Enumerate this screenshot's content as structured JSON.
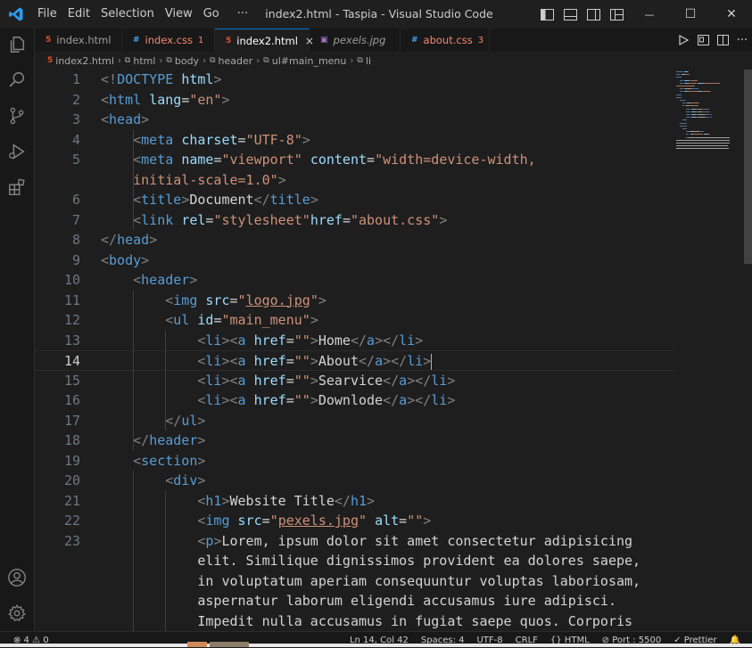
{
  "titlebar": {
    "menu": [
      "File",
      "Edit",
      "Selection",
      "View",
      "Go"
    ],
    "more": "···",
    "window_title": "index2.html - Taspia - Visual Studio Code",
    "win_controls": {
      "minimize": "—",
      "maximize": "☐",
      "close": "✕"
    }
  },
  "tabs": [
    {
      "label": "index.html",
      "icon": "5",
      "icon_color": "#e44d26",
      "active": false,
      "italic": false
    },
    {
      "label": "index.css",
      "icon": "#",
      "icon_color": "#42a5f5",
      "badge": "1",
      "label_color": "#f48771",
      "active": false,
      "italic": false
    },
    {
      "label": "index2.html",
      "icon": "5",
      "icon_color": "#e44d26",
      "active": true,
      "close": "×",
      "italic": false
    },
    {
      "label": "pexels.jpg",
      "icon": "▣",
      "icon_color": "#a074c4",
      "active": false,
      "italic": true
    },
    {
      "label": "about.css",
      "icon": "#",
      "icon_color": "#42a5f5",
      "badge": "3",
      "label_color": "#f48771",
      "active": false,
      "italic": false
    }
  ],
  "breadcrumb": [
    "index2.html",
    "html",
    "body",
    "header",
    "ul#main_menu",
    "li"
  ],
  "editor": {
    "line_numbers": [
      "1",
      "2",
      "3",
      "4",
      "5",
      "",
      "6",
      "7",
      "8",
      "9",
      "10",
      "11",
      "12",
      "13",
      "14",
      "15",
      "16",
      "17",
      "18",
      "19",
      "20",
      "21",
      "22",
      "23",
      "",
      "",
      "",
      ""
    ],
    "current_line": "14",
    "lines": [
      [
        [
          "p",
          "<!"
        ],
        [
          "tag",
          "DOCTYPE"
        ],
        [
          "x",
          " "
        ],
        [
          "attr",
          "html"
        ],
        [
          "p",
          ">"
        ]
      ],
      [
        [
          "p",
          "<"
        ],
        [
          "tag",
          "html"
        ],
        [
          "x",
          " "
        ],
        [
          "attr",
          "lang"
        ],
        [
          "x",
          "="
        ],
        [
          "str",
          "\"en\""
        ],
        [
          "p",
          ">"
        ]
      ],
      [
        [
          "p",
          "<"
        ],
        [
          "tag",
          "head"
        ],
        [
          "p",
          ">"
        ]
      ],
      [
        [
          "x",
          "    "
        ],
        [
          "p",
          "<"
        ],
        [
          "tag",
          "meta"
        ],
        [
          "x",
          " "
        ],
        [
          "attr",
          "charset"
        ],
        [
          "x",
          "="
        ],
        [
          "str",
          "\"UTF-8\""
        ],
        [
          "p",
          ">"
        ]
      ],
      [
        [
          "x",
          "    "
        ],
        [
          "p",
          "<"
        ],
        [
          "tag",
          "meta"
        ],
        [
          "x",
          " "
        ],
        [
          "attr",
          "name"
        ],
        [
          "x",
          "="
        ],
        [
          "str",
          "\"viewport\""
        ],
        [
          "x",
          " "
        ],
        [
          "attr",
          "content"
        ],
        [
          "x",
          "="
        ],
        [
          "str",
          "\"width=device-width,"
        ]
      ],
      [
        [
          "str",
          "    initial-scale=1.0\""
        ],
        [
          "p",
          ">"
        ]
      ],
      [
        [
          "x",
          "    "
        ],
        [
          "p",
          "<"
        ],
        [
          "tag",
          "title"
        ],
        [
          "p",
          ">"
        ],
        [
          "x",
          "Document"
        ],
        [
          "p",
          "</"
        ],
        [
          "tag",
          "title"
        ],
        [
          "p",
          ">"
        ]
      ],
      [
        [
          "x",
          "    "
        ],
        [
          "p",
          "<"
        ],
        [
          "tag",
          "link"
        ],
        [
          "x",
          " "
        ],
        [
          "attr",
          "rel"
        ],
        [
          "x",
          "="
        ],
        [
          "str",
          "\"stylesheet\""
        ],
        [
          "attr",
          "href"
        ],
        [
          "x",
          "="
        ],
        [
          "str",
          "\"about.css\""
        ],
        [
          "p",
          ">"
        ]
      ],
      [
        [
          "p",
          "</"
        ],
        [
          "tag",
          "head"
        ],
        [
          "p",
          ">"
        ]
      ],
      [
        [
          "p",
          "<"
        ],
        [
          "tag",
          "body"
        ],
        [
          "p",
          ">"
        ]
      ],
      [
        [
          "x",
          "    "
        ],
        [
          "p",
          "<"
        ],
        [
          "tag",
          "header"
        ],
        [
          "p",
          ">"
        ]
      ],
      [
        [
          "x",
          "        "
        ],
        [
          "p",
          "<"
        ],
        [
          "tag",
          "img"
        ],
        [
          "x",
          " "
        ],
        [
          "attr",
          "src"
        ],
        [
          "x",
          "="
        ],
        [
          "str",
          "\""
        ],
        [
          "link",
          "logo.jpg"
        ],
        [
          "str",
          "\""
        ],
        [
          "p",
          ">"
        ]
      ],
      [
        [
          "x",
          "        "
        ],
        [
          "p",
          "<"
        ],
        [
          "tag",
          "ul"
        ],
        [
          "x",
          " "
        ],
        [
          "attr",
          "id"
        ],
        [
          "x",
          "="
        ],
        [
          "str",
          "\"main_menu\""
        ],
        [
          "p",
          ">"
        ]
      ],
      [
        [
          "x",
          "            "
        ],
        [
          "p",
          "<"
        ],
        [
          "tag",
          "li"
        ],
        [
          "p",
          "><"
        ],
        [
          "tag",
          "a"
        ],
        [
          "x",
          " "
        ],
        [
          "attr",
          "href"
        ],
        [
          "x",
          "="
        ],
        [
          "str",
          "\"\""
        ],
        [
          "p",
          ">"
        ],
        [
          "x",
          "Home"
        ],
        [
          "p",
          "</"
        ],
        [
          "tag",
          "a"
        ],
        [
          "p",
          "></"
        ],
        [
          "tag",
          "li"
        ],
        [
          "p",
          ">"
        ]
      ],
      [
        [
          "x",
          "            "
        ],
        [
          "p",
          "<"
        ],
        [
          "tag",
          "li"
        ],
        [
          "p",
          "><"
        ],
        [
          "tag",
          "a"
        ],
        [
          "x",
          " "
        ],
        [
          "attr",
          "href"
        ],
        [
          "x",
          "="
        ],
        [
          "str",
          "\"\""
        ],
        [
          "p",
          ">"
        ],
        [
          "x",
          "About"
        ],
        [
          "p",
          "</"
        ],
        [
          "tag",
          "a"
        ],
        [
          "p",
          "></"
        ],
        [
          "tag",
          "li"
        ],
        [
          "p",
          ">"
        ]
      ],
      [
        [
          "x",
          "            "
        ],
        [
          "p",
          "<"
        ],
        [
          "tag",
          "li"
        ],
        [
          "p",
          "><"
        ],
        [
          "tag",
          "a"
        ],
        [
          "x",
          " "
        ],
        [
          "attr",
          "href"
        ],
        [
          "x",
          "="
        ],
        [
          "str",
          "\"\""
        ],
        [
          "p",
          ">"
        ],
        [
          "x",
          "Searvice"
        ],
        [
          "p",
          "</"
        ],
        [
          "tag",
          "a"
        ],
        [
          "p",
          "></"
        ],
        [
          "tag",
          "li"
        ],
        [
          "p",
          ">"
        ]
      ],
      [
        [
          "x",
          "            "
        ],
        [
          "p",
          "<"
        ],
        [
          "tag",
          "li"
        ],
        [
          "p",
          "><"
        ],
        [
          "tag",
          "a"
        ],
        [
          "x",
          " "
        ],
        [
          "attr",
          "href"
        ],
        [
          "x",
          "="
        ],
        [
          "str",
          "\"\""
        ],
        [
          "p",
          ">"
        ],
        [
          "x",
          "Downlode"
        ],
        [
          "p",
          "</"
        ],
        [
          "tag",
          "a"
        ],
        [
          "p",
          "></"
        ],
        [
          "tag",
          "li"
        ],
        [
          "p",
          ">"
        ]
      ],
      [
        [
          "x",
          "        "
        ],
        [
          "p",
          "</"
        ],
        [
          "tag",
          "ul"
        ],
        [
          "p",
          ">"
        ]
      ],
      [
        [
          "x",
          "    "
        ],
        [
          "p",
          "</"
        ],
        [
          "tag",
          "header"
        ],
        [
          "p",
          ">"
        ]
      ],
      [
        [
          "x",
          "    "
        ],
        [
          "p",
          "<"
        ],
        [
          "tag",
          "section"
        ],
        [
          "p",
          ">"
        ]
      ],
      [
        [
          "x",
          "        "
        ],
        [
          "p",
          "<"
        ],
        [
          "tag",
          "div"
        ],
        [
          "p",
          ">"
        ]
      ],
      [
        [
          "x",
          "            "
        ],
        [
          "p",
          "<"
        ],
        [
          "tag",
          "h1"
        ],
        [
          "p",
          ">"
        ],
        [
          "x",
          "Website Title"
        ],
        [
          "p",
          "</"
        ],
        [
          "tag",
          "h1"
        ],
        [
          "p",
          ">"
        ]
      ],
      [
        [
          "x",
          "            "
        ],
        [
          "p",
          "<"
        ],
        [
          "tag",
          "img"
        ],
        [
          "x",
          " "
        ],
        [
          "attr",
          "src"
        ],
        [
          "x",
          "="
        ],
        [
          "str",
          "\""
        ],
        [
          "link",
          "pexels.jpg"
        ],
        [
          "str",
          "\""
        ],
        [
          "x",
          " "
        ],
        [
          "attr",
          "alt"
        ],
        [
          "x",
          "="
        ],
        [
          "str",
          "\"\""
        ],
        [
          "p",
          ">"
        ]
      ],
      [
        [
          "x",
          "            "
        ],
        [
          "p",
          "<"
        ],
        [
          "tag",
          "p"
        ],
        [
          "p",
          ">"
        ],
        [
          "x",
          "Lorem, ipsum dolor sit amet consectetur adipisicing"
        ]
      ],
      [
        [
          "x",
          "            elit. Similique dignissimos provident ea dolores saepe,"
        ]
      ],
      [
        [
          "x",
          "            in voluptatum aperiam consequuntur voluptas laboriosam,"
        ]
      ],
      [
        [
          "x",
          "            aspernatur laborum eligendi accusamus iure adipisci."
        ]
      ],
      [
        [
          "x",
          "            Impedit nulla accusamus in fugiat saepe quos. Corporis"
        ]
      ]
    ]
  },
  "statusbar": {
    "problems": "⊗ 4 ⚠ 0",
    "position": "Ln 14, Col 42",
    "spaces": "Spaces: 4",
    "encoding": "UTF-8",
    "eol": "CRLF",
    "language": "{} HTML",
    "port": "⊘ Port : 5500",
    "prettier": "✓ Prettier",
    "feedback": "🔔"
  },
  "colors": {
    "accent": "#0078d4",
    "tag": "#569cd6",
    "attr": "#9cdcfe",
    "string": "#ce9178",
    "punct": "#808080"
  },
  "icons": [
    "vscode-logo-icon",
    "explorer-icon",
    "search-icon",
    "source-control-icon",
    "run-debug-icon",
    "extensions-icon",
    "account-icon",
    "settings-gear-icon"
  ]
}
